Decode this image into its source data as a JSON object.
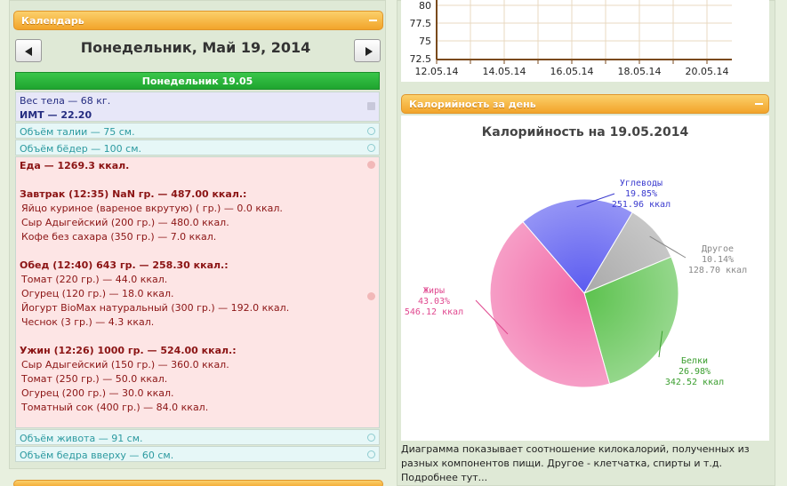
{
  "calendar": {
    "header": "Календарь",
    "date_title": "Понедельник, Май 19, 2014",
    "day_bar": "Понедельник 19.05",
    "body": {
      "weight": "Вес тела — 68 кг.",
      "bmi": "ИМТ — 22.20"
    },
    "measures_top": [
      "Объём талии — 75 см.",
      "Объём бёдер — 100 см."
    ],
    "food": {
      "total": "Еда — 1269.3 ккал.",
      "meals": [
        {
          "title": "Завтрак (12:35) NaN гр. — 487.00 ккал.:",
          "items": [
            "Яйцо куриное (вареное вкрутую) ( гр.) — 0.0 ккал.",
            "Сыр Адыгейский (200 гр.) — 480.0 ккал.",
            "Кофе без сахара (350 гр.) — 7.0 ккал."
          ]
        },
        {
          "title": "Обед (12:40) 643 гр. — 258.30 ккал.:",
          "items": [
            "Томат (220 гр.) — 44.0 ккал.",
            "Огурец (120 гр.) — 18.0 ккал.",
            "Йогурт BioMax натуральный (300 гр.) — 192.0 ккал.",
            "Чеснок (3 гр.) — 4.3 ккал."
          ]
        },
        {
          "title": "Ужин (12:26) 1000 гр. — 524.00 ккал.:",
          "items": [
            "Сыр Адыгейский (150 гр.) — 360.0 ккал.",
            "Томат (250 гр.) — 50.0 ккал.",
            "Огурец (200 гр.) — 30.0 ккал.",
            "Томатный сок (400 гр.) — 84.0 ккал."
          ]
        }
      ]
    },
    "measures_bottom": [
      "Объём живота — 91 см.",
      "Объём бедра вверху — 60 см."
    ]
  },
  "weight_chart": {
    "y_ticks": [
      "80",
      "77.5",
      "75",
      "72.5"
    ],
    "x_ticks": [
      "12.05.14",
      "14.05.14",
      "16.05.14",
      "18.05.14",
      "20.05.14"
    ]
  },
  "calories_panel": {
    "header": "Калорийность за день",
    "caption": "Диаграмма показывает соотношение килокалорий, полученных из разных компонентов пищи. Другое - клетчатка, спирты и т.д. Подробнее тут..."
  },
  "chart_data": {
    "type": "pie",
    "title": "Калорийность на 19.05.2014",
    "slices": [
      {
        "name": "Углеводы",
        "percent": "19.85%",
        "kcal": "251.96 ккал",
        "value": 19.85,
        "color": "#5b5bf0"
      },
      {
        "name": "Другое",
        "percent": "10.14%",
        "kcal": "128.70 ккал",
        "value": 10.14,
        "color": "#a9a9a9"
      },
      {
        "name": "Белки",
        "percent": "26.98%",
        "kcal": "342.52 ккал",
        "value": 26.98,
        "color": "#5cc24e"
      },
      {
        "name": "Жиры",
        "percent": "43.03%",
        "kcal": "546.12 ккал",
        "value": 43.03,
        "color": "#f26aa8"
      }
    ]
  }
}
